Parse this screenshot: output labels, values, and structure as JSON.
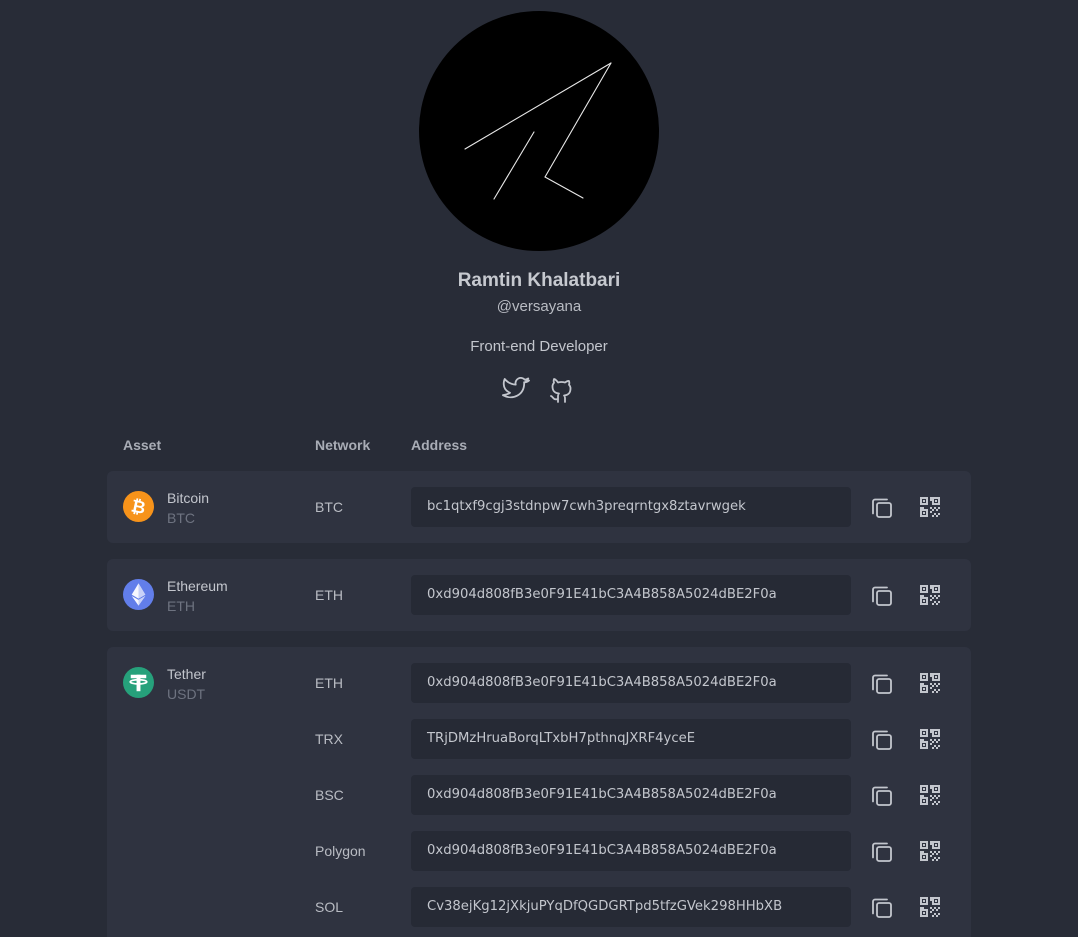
{
  "profile": {
    "name": "Ramtin Khalatbari",
    "handle": "@versayana",
    "bio": "Front-end Developer",
    "socials": [
      {
        "name": "twitter-icon"
      },
      {
        "name": "github-icon"
      }
    ]
  },
  "table": {
    "headers": {
      "asset": "Asset",
      "network": "Network",
      "address": "Address"
    },
    "assets": [
      {
        "name": "Bitcoin",
        "ticker": "BTC",
        "icon": "bitcoin-icon",
        "color": "#f7931a",
        "rows": [
          {
            "network": "BTC",
            "address": "bc1qtxf9cgj3stdnpw7cwh3preqrntgx8ztavrwgek"
          }
        ]
      },
      {
        "name": "Ethereum",
        "ticker": "ETH",
        "icon": "ethereum-icon",
        "color": "#627eea",
        "rows": [
          {
            "network": "ETH",
            "address": "0xd904d808fB3e0F91E41bC3A4B858A5024dBE2F0a"
          }
        ]
      },
      {
        "name": "Tether",
        "ticker": "USDT",
        "icon": "tether-icon",
        "color": "#26a17b",
        "rows": [
          {
            "network": "ETH",
            "address": "0xd904d808fB3e0F91E41bC3A4B858A5024dBE2F0a"
          },
          {
            "network": "TRX",
            "address": "TRjDMzHruaBorqLTxbH7pthnqJXRF4yceE"
          },
          {
            "network": "BSC",
            "address": "0xd904d808fB3e0F91E41bC3A4B858A5024dBE2F0a"
          },
          {
            "network": "Polygon",
            "address": "0xd904d808fB3e0F91E41bC3A4B858A5024dBE2F0a"
          },
          {
            "network": "SOL",
            "address": "Cv38ejKg12jXkjuPYqDfQGDGRTpd5tfzGVek298HHbXB"
          }
        ]
      }
    ]
  },
  "colors": {
    "background": "#282c37",
    "card": "#2f3340",
    "address_field": "#262a35"
  }
}
